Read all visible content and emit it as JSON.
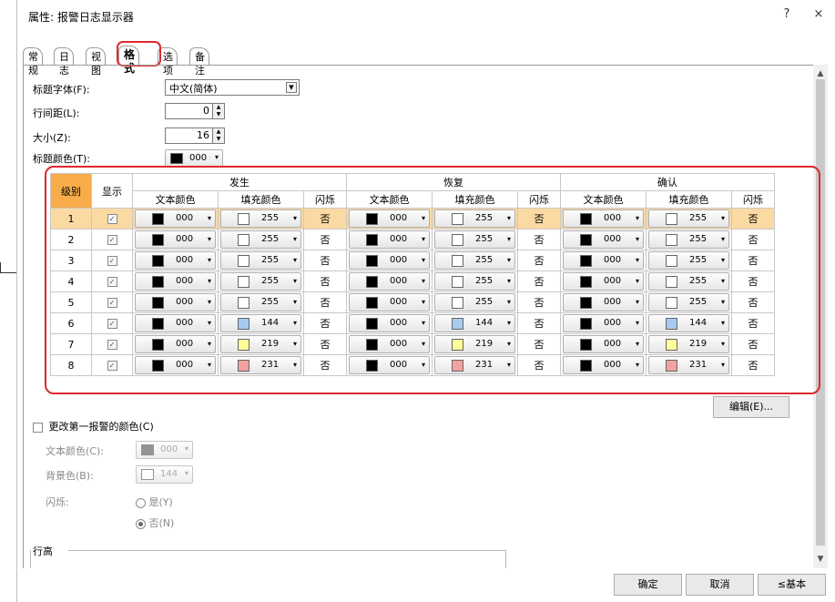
{
  "window": {
    "title": "属性: 报警日志显示器",
    "help": "?",
    "close": "×"
  },
  "tabs": [
    {
      "label": "常规"
    },
    {
      "label": "日志"
    },
    {
      "label": "视图"
    },
    {
      "label": "格式",
      "active": true
    },
    {
      "label": "选项"
    },
    {
      "label": "备注"
    }
  ],
  "fields": {
    "title_font": {
      "label": "标题字体(F):",
      "value": "中文(简体)"
    },
    "line_spacing": {
      "label": "行间距(L):",
      "value": "0"
    },
    "size": {
      "label": "大小(Z):",
      "value": "16"
    },
    "title_color": {
      "label": "标题颜色(T):",
      "value": "000",
      "swatch": "#000000"
    }
  },
  "grid": {
    "headers": {
      "level": "级别",
      "show": "显示",
      "groups": [
        "发生",
        "恢复",
        "确认"
      ],
      "text_color": "文本颜色",
      "fill_color": "填充颜色",
      "blink": "闪烁"
    },
    "rows": [
      {
        "level": "1",
        "show": "✓",
        "fill": "255",
        "fill_hex": "#ffffff",
        "text": "000",
        "blink": "否",
        "selected": true
      },
      {
        "level": "2",
        "show": "✓",
        "fill": "255",
        "fill_hex": "#ffffff",
        "text": "000",
        "blink": "否"
      },
      {
        "level": "3",
        "show": "✓",
        "fill": "255",
        "fill_hex": "#ffffff",
        "text": "000",
        "blink": "否"
      },
      {
        "level": "4",
        "show": "✓",
        "fill": "255",
        "fill_hex": "#ffffff",
        "text": "000",
        "blink": "否"
      },
      {
        "level": "5",
        "show": "✓",
        "fill": "255",
        "fill_hex": "#ffffff",
        "text": "000",
        "blink": "否"
      },
      {
        "level": "6",
        "show": "✓",
        "fill": "144",
        "fill_hex": "#a6caf0",
        "text": "000",
        "blink": "否"
      },
      {
        "level": "7",
        "show": "✓",
        "fill": "219",
        "fill_hex": "#ffff99",
        "text": "000",
        "blink": "否"
      },
      {
        "level": "8",
        "show": "✓",
        "fill": "231",
        "fill_hex": "#f4a1a1",
        "text": "000",
        "blink": "否"
      }
    ]
  },
  "edit_button": "编辑(E)...",
  "first_alarm": {
    "checkbox_label": "更改第一报警的颜色(C)",
    "text_color_label": "文本颜色(C):",
    "text_color_value": "000",
    "bg_label": "背景色(B):",
    "bg_value": "144",
    "blink_label": "闪烁:",
    "yes": "是(Y)",
    "no": "否(N)"
  },
  "row_height_label": "行高",
  "footer": {
    "ok": "确定",
    "cancel": "取消",
    "basic": "≤基本"
  },
  "colors": {
    "highlight": "#e0282e",
    "selected_row": "#fbd9a3",
    "level_header": "#f9ad4a"
  }
}
